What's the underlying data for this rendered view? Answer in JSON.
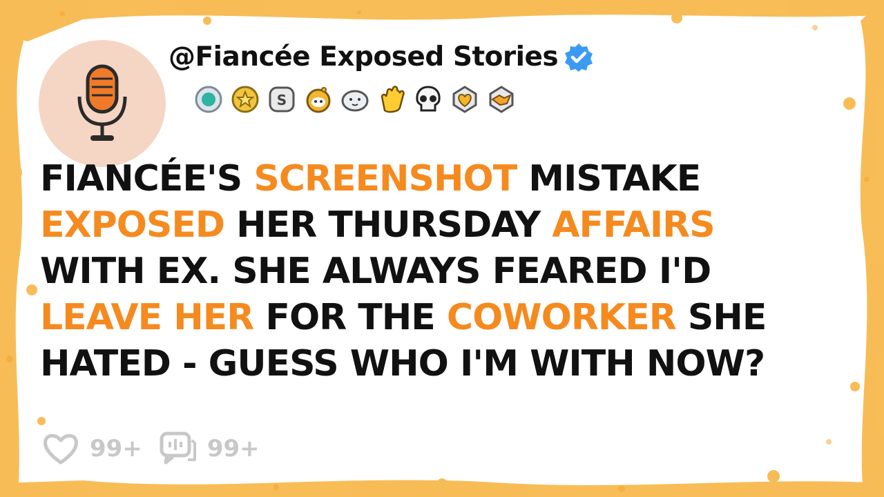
{
  "channel": {
    "handle": "@Fiancée Exposed Stories",
    "avatar_icon": "microphone-icon",
    "verified_icon": "verified-check-icon",
    "badges": [
      "medal-icon",
      "star-icon",
      "s-badge-icon",
      "reddit-gold-icon",
      "seal-icon",
      "clap-hands-icon",
      "skull-icon",
      "diamond-heart-icon",
      "handshake-icon"
    ]
  },
  "headline": {
    "lines": [
      [
        {
          "t": "Fiancée's ",
          "h": false
        },
        {
          "t": "Screenshot",
          "h": true
        },
        {
          "t": " Mistake",
          "h": false
        }
      ],
      [
        {
          "t": "Exposed",
          "h": true
        },
        {
          "t": " Her Thursday ",
          "h": false
        },
        {
          "t": "Affairs",
          "h": true
        }
      ],
      [
        {
          "t": "With Ex. She Always Feared I'd",
          "h": false
        }
      ],
      [
        {
          "t": "Leave Her",
          "h": true
        },
        {
          "t": " For The ",
          "h": false
        },
        {
          "t": "Coworker",
          "h": true
        },
        {
          "t": " She",
          "h": false
        }
      ],
      [
        {
          "t": "Hated - Guess Who I'm With Now?",
          "h": false
        }
      ]
    ]
  },
  "stats": {
    "likes_icon": "heart-icon",
    "likes": "99+",
    "comments_icon": "comment-icon",
    "comments": "99+"
  },
  "colors": {
    "accent": "#f58a1f",
    "text": "#111111",
    "avatar_bg": "#f5d5c3",
    "verified": "#3b9bf2",
    "muted": "#c8c8c8"
  }
}
